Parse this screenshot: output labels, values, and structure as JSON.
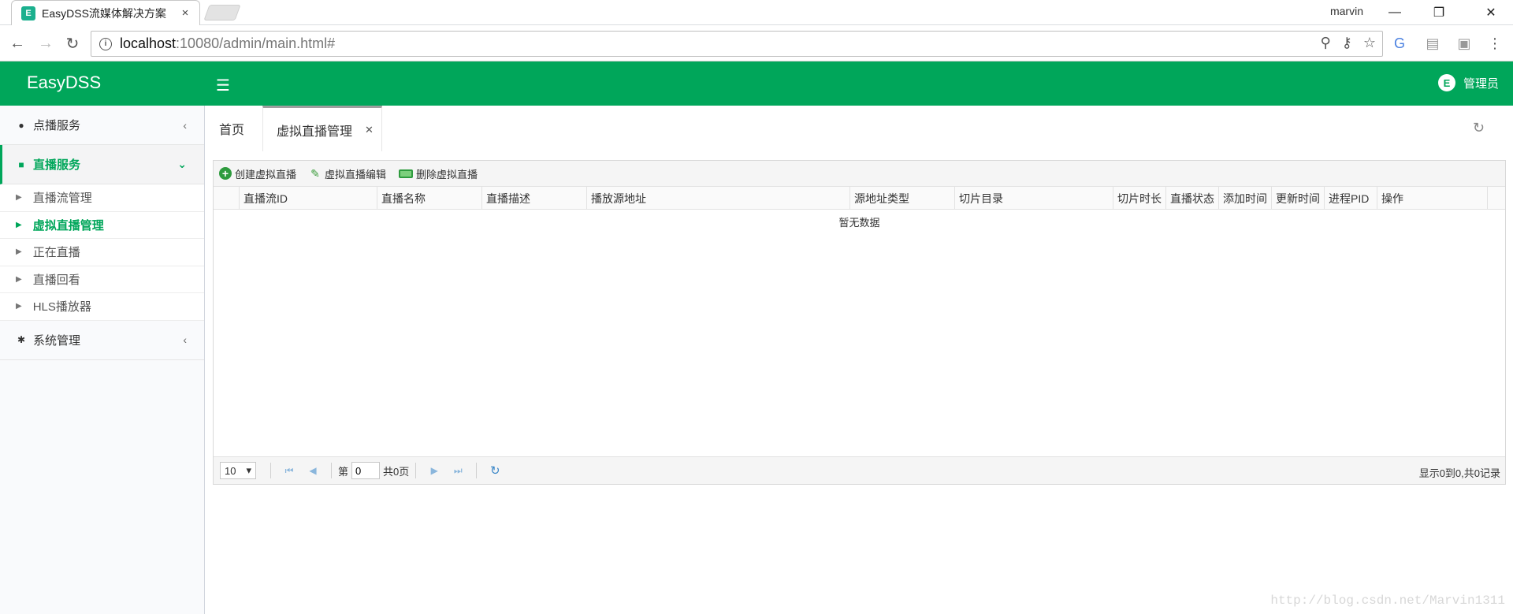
{
  "browser": {
    "tab_title": "EasyDSS流媒体解决方案",
    "tab_favicon": "E",
    "profile": "marvin",
    "url_host": "localhost",
    "url_path": ":10080/admin/main.html#"
  },
  "header": {
    "logo": "EasyDSS",
    "user": "管理员",
    "user_avatar": "E",
    "accent_color": "#00a65a"
  },
  "sidebar": {
    "groups": [
      {
        "label": "点播服务",
        "icon": "play-circle-icon"
      },
      {
        "label": "直播服务",
        "icon": "video-camera-icon"
      },
      {
        "label": "系统管理",
        "icon": "gear-icon"
      }
    ],
    "live_items": [
      "直播流管理",
      "虚拟直播管理",
      "正在直播",
      "直播回看",
      "HLS播放器"
    ]
  },
  "tabs": {
    "home": "首页",
    "current": "虚拟直播管理"
  },
  "grid": {
    "toolbar": {
      "create": "创建虚拟直播",
      "edit": "虚拟直播编辑",
      "delete": "删除虚拟直播"
    },
    "columns": [
      "直播流ID",
      "直播名称",
      "直播描述",
      "播放源地址",
      "源地址类型",
      "切片目录",
      "切片时长",
      "直播状态",
      "添加时间",
      "更新时间",
      "进程PID",
      "操作"
    ],
    "empty_text": "暂无数据",
    "pager": {
      "page_size": "10",
      "page_prefix": "第",
      "page_value": "0",
      "page_total": "共0页",
      "info": "显示0到0,共0记录"
    }
  },
  "watermark": "http://blog.csdn.net/Marvin1311"
}
